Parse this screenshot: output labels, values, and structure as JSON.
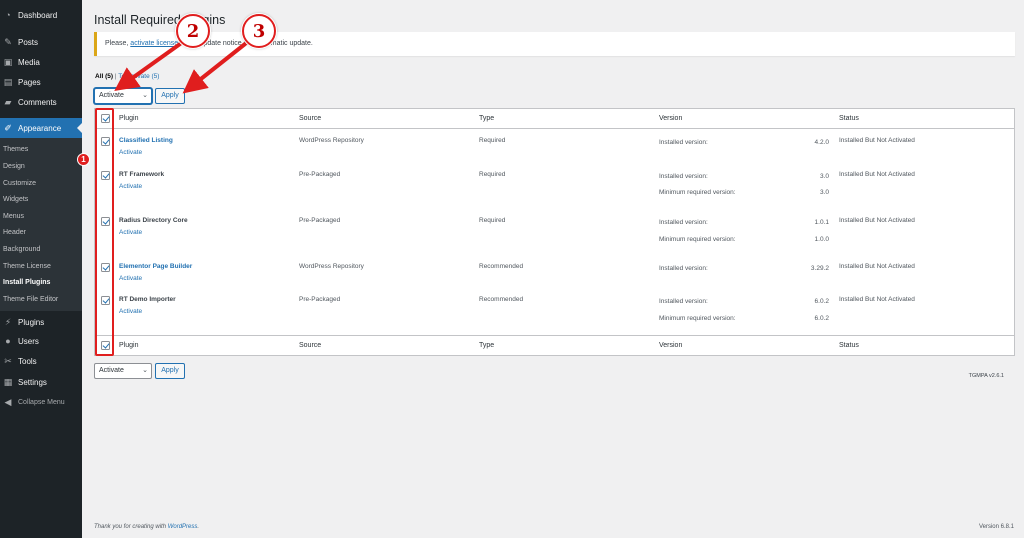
{
  "sidebar": {
    "items": [
      {
        "label": "Dashboard",
        "icon": "dashboard-icon"
      },
      {
        "label": "Posts",
        "icon": "pin-icon"
      },
      {
        "label": "Media",
        "icon": "media-icon"
      },
      {
        "label": "Pages",
        "icon": "page-icon"
      },
      {
        "label": "Comments",
        "icon": "comment-icon"
      },
      {
        "label": "Appearance",
        "icon": "brush-icon"
      },
      {
        "label": "Plugins",
        "icon": "plugin-icon"
      },
      {
        "label": "Users",
        "icon": "user-icon"
      },
      {
        "label": "Tools",
        "icon": "wrench-icon"
      },
      {
        "label": "Settings",
        "icon": "settings-icon"
      },
      {
        "label": "Collapse Menu",
        "icon": "collapse-icon"
      }
    ],
    "submenu": [
      "Themes",
      "Design",
      "Customize",
      "Widgets",
      "Menus",
      "Header",
      "Background",
      "Theme License",
      "Install Plugins",
      "Theme File Editor"
    ]
  },
  "page": {
    "title": "Install Required Plugins",
    "notice": {
      "prefix": "Please, ",
      "link": "activate license",
      "suffix": " to get update notice and automatic update."
    }
  },
  "filters": {
    "all": "All (5)",
    "separator": "|",
    "to_activate": "To Activate (5)"
  },
  "bulk": {
    "action": "Activate",
    "apply": "Apply"
  },
  "table": {
    "columns": [
      "Plugin",
      "Source",
      "Type",
      "Version",
      "Status"
    ],
    "rows": [
      {
        "plugin": "Classified Listing",
        "action": "Activate",
        "source": "WordPress Repository",
        "type": "Required",
        "installed_label": "Installed version:",
        "installed": "4.2.0",
        "minimum_label": "",
        "minimum": "",
        "status": "Installed But Not Activated"
      },
      {
        "plugin": "RT Framework",
        "action": "Activate",
        "source": "Pre-Packaged",
        "type": "Required",
        "installed_label": "Installed version:",
        "installed": "3.0",
        "minimum_label": "Minimum required version:",
        "minimum": "3.0",
        "status": "Installed But Not Activated"
      },
      {
        "plugin": "Radius Directory Core",
        "action": "Activate",
        "source": "Pre-Packaged",
        "type": "Required",
        "installed_label": "Installed version:",
        "installed": "1.0.1",
        "minimum_label": "Minimum required version:",
        "minimum": "1.0.0",
        "status": "Installed But Not Activated"
      },
      {
        "plugin": "Elementor Page Builder",
        "action": "Activate",
        "source": "WordPress Repository",
        "type": "Recommended",
        "installed_label": "Installed version:",
        "installed": "3.29.2",
        "minimum_label": "",
        "minimum": "",
        "status": "Installed But Not Activated"
      },
      {
        "plugin": "RT Demo Importer",
        "action": "Activate",
        "source": "Pre-Packaged",
        "type": "Recommended",
        "installed_label": "Installed version:",
        "installed": "6.0.2",
        "minimum_label": "Minimum required version:",
        "minimum": "6.0.2",
        "status": "Installed But Not Activated"
      }
    ]
  },
  "tgmpa_version": "TGMPA v2.6.1",
  "footer": {
    "thanks_prefix": "Thank you for creating with ",
    "thanks_link": "WordPress",
    "thanks_suffix": ".",
    "version": "Version 6.8.1"
  },
  "annotations": {
    "step1": "1",
    "step2": "2",
    "step3": "3",
    "color": "#e01e1e"
  },
  "colors": {
    "sidebar": "#1d2327",
    "accent": "#2271b1",
    "notice_border": "#dba617"
  }
}
